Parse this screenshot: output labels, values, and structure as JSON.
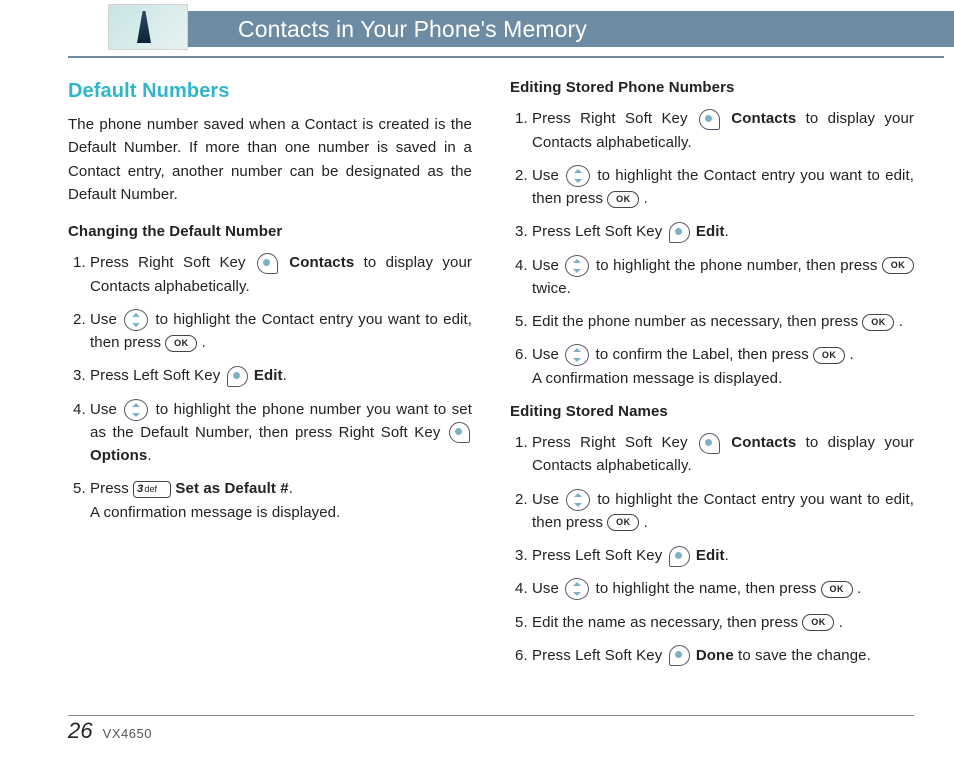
{
  "header": {
    "title": "Contacts in Your Phone's Memory"
  },
  "left": {
    "heading": "Default Numbers",
    "intro": "The phone number saved when a Contact is created is the Default Number. If more than one number is saved in a Contact entry, another number can be designated as the Default Number.",
    "sub1": "Changing the Default Number",
    "s1": {
      "a": "Press Right Soft Key",
      "b": "Contacts",
      "c": "to display your Contacts alphabetically."
    },
    "s2": {
      "a": "Use",
      "b": "to highlight the Contact entry you want to edit, then press",
      "c": "."
    },
    "s3": {
      "a": "Press Left Soft Key",
      "b": "Edit",
      "c": "."
    },
    "s4": {
      "a": "Use",
      "b": "to highlight the phone number you want to set as the Default Number, then press Right Soft Key",
      "c": "Options",
      "d": "."
    },
    "s5": {
      "a": "Press",
      "b": "Set as Default #",
      "c": ".",
      "d": "A confirmation message is displayed."
    }
  },
  "right": {
    "sub1": "Editing Stored Phone Numbers",
    "e1": {
      "a": "Press Right Soft Key",
      "b": "Contacts",
      "c": "to display your Contacts alphabetically."
    },
    "e2": {
      "a": "Use",
      "b": "to highlight the Contact entry you want to edit, then press",
      "c": "."
    },
    "e3": {
      "a": "Press Left Soft Key",
      "b": "Edit",
      "c": "."
    },
    "e4": {
      "a": "Use",
      "b": "to highlight the phone number, then press",
      "c": "twice."
    },
    "e5": {
      "a": "Edit the phone number as necessary, then press",
      "b": "."
    },
    "e6": {
      "a": "Use",
      "b": "to confirm the Label, then press",
      "c": ".",
      "d": "A confirmation message is displayed."
    },
    "sub2": "Editing Stored Names",
    "n1": {
      "a": "Press Right Soft Key",
      "b": "Contacts",
      "c": "to display your Contacts alphabetically."
    },
    "n2": {
      "a": "Use",
      "b": "to highlight the Contact entry you want to edit, then press",
      "c": "."
    },
    "n3": {
      "a": "Press Left Soft Key",
      "b": "Edit",
      "c": "."
    },
    "n4": {
      "a": "Use",
      "b": "to highlight the name, then press",
      "c": "."
    },
    "n5": {
      "a": "Edit the name as necessary, then press",
      "b": "."
    },
    "n6": {
      "a": "Press Left Soft Key",
      "b": "Done",
      "c": "to save the change."
    }
  },
  "keys": {
    "ok": "OK",
    "three": "3",
    "def": "def"
  },
  "footer": {
    "page": "26",
    "model": "VX4650"
  }
}
